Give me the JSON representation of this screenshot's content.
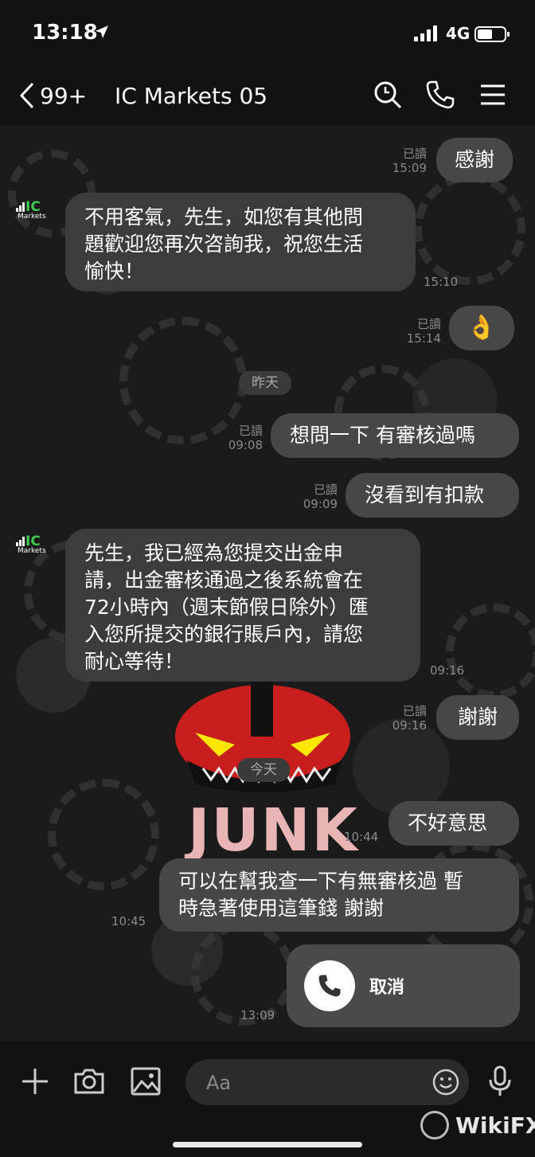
{
  "status_bar": {
    "time": "13:18",
    "network": "4G"
  },
  "header": {
    "unread_count": "99+",
    "title": "IC Markets 05"
  },
  "avatar": {
    "brand": "IC",
    "brand_sub": "Markets"
  },
  "messages": [
    {
      "text": "感謝",
      "read": "已讀",
      "time": "15:09"
    },
    {
      "text_lines": [
        "不用客氣，先生，如您有其他問",
        "題歡迎您再次咨詢我，祝您生活",
        "愉快！"
      ],
      "time": "15:10"
    },
    {
      "emoji": "👌",
      "read": "已讀",
      "time": "15:14"
    },
    {
      "date": "昨天"
    },
    {
      "text": "想問一下 有審核過嗎",
      "read": "已讀",
      "time": "09:08"
    },
    {
      "text": "沒看到有扣款",
      "read": "已讀",
      "time": "09:09"
    },
    {
      "text_lines": [
        "先生，我已經為您提交出金申",
        "請，出金審核通過之後系統會在",
        "72小時內（週末節假日除外）匯",
        "入您所提交的銀行賬戶內，請您",
        "耐心等待！"
      ],
      "time": "09:16"
    },
    {
      "text": "謝謝",
      "read": "已讀",
      "time": "09:16"
    },
    {
      "date": "今天"
    },
    {
      "text": "不好意思",
      "time": "10:44"
    },
    {
      "text_lines": [
        "可以在幫我查一下有無審核過 暫",
        "時急著使用這筆錢 謝謝"
      ],
      "time": "10:45"
    },
    {
      "call_label": "取消",
      "time": "13:09"
    }
  ],
  "wallpaper_text": "JUNK",
  "input": {
    "placeholder": "Aa"
  },
  "watermark": "WikiFX",
  "colors": {
    "brand_green": "#3ec94f",
    "bubble": "#3c3c3c",
    "background": "#141414"
  }
}
